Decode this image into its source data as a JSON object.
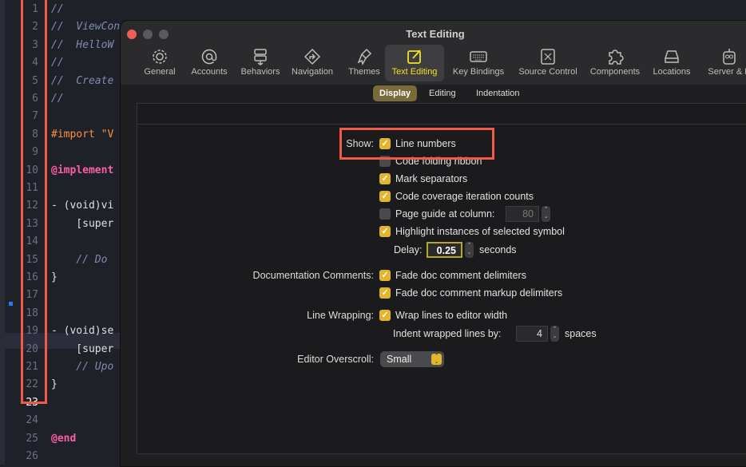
{
  "editor": {
    "line_numbers": [
      "1",
      "2",
      "3",
      "4",
      "5",
      "6",
      "7",
      "8",
      "9",
      "10",
      "11",
      "12",
      "13",
      "14",
      "15",
      "16",
      "17",
      "18",
      "19",
      "20",
      "21",
      "22",
      "23",
      "24",
      "25",
      "26"
    ],
    "current_line": "23",
    "code_lines": [
      {
        "n": 1,
        "text": "//",
        "cls": "cmt"
      },
      {
        "n": 2,
        "text": "//  ViewController",
        "cls": "cmt"
      },
      {
        "n": 3,
        "text": "//  HelloW",
        "cls": "cmt"
      },
      {
        "n": 4,
        "text": "//",
        "cls": "cmt"
      },
      {
        "n": 5,
        "text": "//  Create",
        "cls": "cmt"
      },
      {
        "n": 6,
        "text": "//",
        "cls": "cmt"
      },
      {
        "n": 8,
        "text": "#import \"V",
        "cls": "pp"
      },
      {
        "n": 10,
        "text": "@implement",
        "cls": "kw"
      },
      {
        "n": 12,
        "text": "- (void)vi",
        "cls": ""
      },
      {
        "n": 13,
        "text": "    [super",
        "cls": ""
      },
      {
        "n": 15,
        "text": "    // Do",
        "cls": "cmt"
      },
      {
        "n": 16,
        "text": "}",
        "cls": ""
      },
      {
        "n": 19,
        "text": "- (void)se",
        "cls": ""
      },
      {
        "n": 20,
        "text": "    [super",
        "cls": ""
      },
      {
        "n": 21,
        "text": "    // Upo",
        "cls": "cmt"
      },
      {
        "n": 22,
        "text": "}",
        "cls": ""
      },
      {
        "n": 25,
        "text": "@end",
        "cls": "kw"
      }
    ]
  },
  "window": {
    "title": "Text Editing",
    "toolbar": [
      {
        "label": "General",
        "icon": "gear-icon"
      },
      {
        "label": "Accounts",
        "icon": "at-icon"
      },
      {
        "label": "Behaviors",
        "icon": "behaviors-icon"
      },
      {
        "label": "Navigation",
        "icon": "navigation-icon"
      },
      {
        "label": "Themes",
        "icon": "brush-icon"
      },
      {
        "label": "Text Editing",
        "icon": "pencil-square-icon",
        "selected": true
      },
      {
        "label": "Key Bindings",
        "icon": "keyboard-icon"
      },
      {
        "label": "Source Control",
        "icon": "source-control-icon"
      },
      {
        "label": "Components",
        "icon": "puzzle-icon"
      },
      {
        "label": "Locations",
        "icon": "drive-icon"
      },
      {
        "label": "Server & B",
        "icon": "robot-icon"
      }
    ],
    "tabs": [
      "Display",
      "Editing",
      "Indentation"
    ],
    "selected_tab": "Display"
  },
  "form": {
    "show_label": "Show:",
    "line_numbers": {
      "label": "Line numbers",
      "checked": true
    },
    "code_folding": {
      "label": "Code folding ribbon",
      "checked": false
    },
    "mark_separators": {
      "label": "Mark separators",
      "checked": true
    },
    "code_coverage": {
      "label": "Code coverage iteration counts",
      "checked": true
    },
    "page_guide": {
      "label": "Page guide at column:",
      "checked": false,
      "value": "80"
    },
    "highlight": {
      "label": "Highlight instances of selected symbol",
      "checked": true
    },
    "delay_label": "Delay:",
    "delay_value": "0.25",
    "delay_unit": "seconds",
    "doc_label": "Documentation Comments:",
    "fade_delims": {
      "label": "Fade doc comment delimiters",
      "checked": true
    },
    "fade_markup": {
      "label": "Fade doc comment markup delimiters",
      "checked": true
    },
    "wrap_label": "Line Wrapping:",
    "wrap": {
      "label": "Wrap lines to editor width",
      "checked": true
    },
    "indent_label": "Indent wrapped lines by:",
    "indent_value": "4",
    "indent_unit": "spaces",
    "overscroll_label": "Editor Overscroll:",
    "overscroll_value": "Small"
  },
  "colors": {
    "accent": "#e1b52c",
    "highlight_box": "#f05a48",
    "selected_tool": "#f5e31b"
  }
}
